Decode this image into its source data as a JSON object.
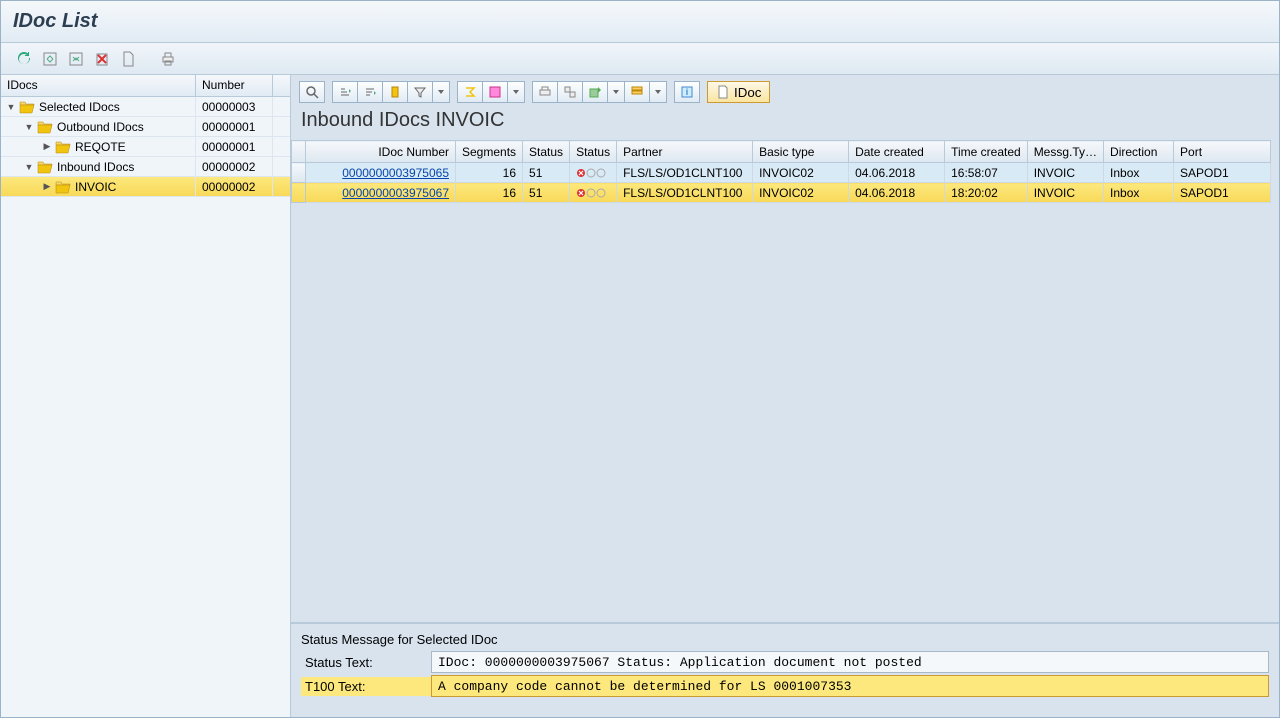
{
  "title": "IDoc List",
  "tree": {
    "header_idocs": "IDocs",
    "header_number": "Number",
    "nodes": [
      {
        "indent": 0,
        "expander": "down",
        "label": "Selected IDocs",
        "number": "00000003",
        "selected": false
      },
      {
        "indent": 1,
        "expander": "down",
        "label": "Outbound IDocs",
        "number": "00000001",
        "selected": false
      },
      {
        "indent": 2,
        "expander": "right",
        "label": "REQOTE",
        "number": "00000001",
        "selected": false
      },
      {
        "indent": 1,
        "expander": "down",
        "label": "Inbound IDocs",
        "number": "00000002",
        "selected": false
      },
      {
        "indent": 2,
        "expander": "right",
        "label": "INVOIC",
        "number": "00000002",
        "selected": true
      }
    ]
  },
  "content": {
    "heading": "Inbound IDocs  INVOIC",
    "idoc_btn": "IDoc",
    "columns": {
      "idoc_number": "IDoc Number",
      "segments": "Segments",
      "status": "Status",
      "status_icon": "Status",
      "partner": "Partner",
      "basic_type": "Basic type",
      "date_created": "Date created",
      "time_created": "Time created",
      "msg_type": "Messg.Ty…",
      "direction": "Direction",
      "port": "Port"
    },
    "rows": [
      {
        "idoc_number": "0000000003975065",
        "segments": "16",
        "status": "51",
        "partner": "FLS/LS/OD1CLNT100",
        "basic_type": "INVOIC02",
        "date_created": "04.06.2018",
        "time_created": "16:58:07",
        "msg_type": "INVOIC",
        "direction": "Inbox",
        "port": "SAPOD1",
        "selected": false
      },
      {
        "idoc_number": "0000000003975067",
        "segments": "16",
        "status": "51",
        "partner": "FLS/LS/OD1CLNT100",
        "basic_type": "INVOIC02",
        "date_created": "04.06.2018",
        "time_created": "18:20:02",
        "msg_type": "INVOIC",
        "direction": "Inbox",
        "port": "SAPOD1",
        "selected": true
      }
    ]
  },
  "status_panel": {
    "title": "Status Message for Selected IDoc",
    "status_label": "Status Text:",
    "status_value": "IDoc: 0000000003975067 Status: Application document not posted",
    "t100_label": "T100 Text:",
    "t100_value": "A company code cannot be determined for LS 0001007353"
  }
}
